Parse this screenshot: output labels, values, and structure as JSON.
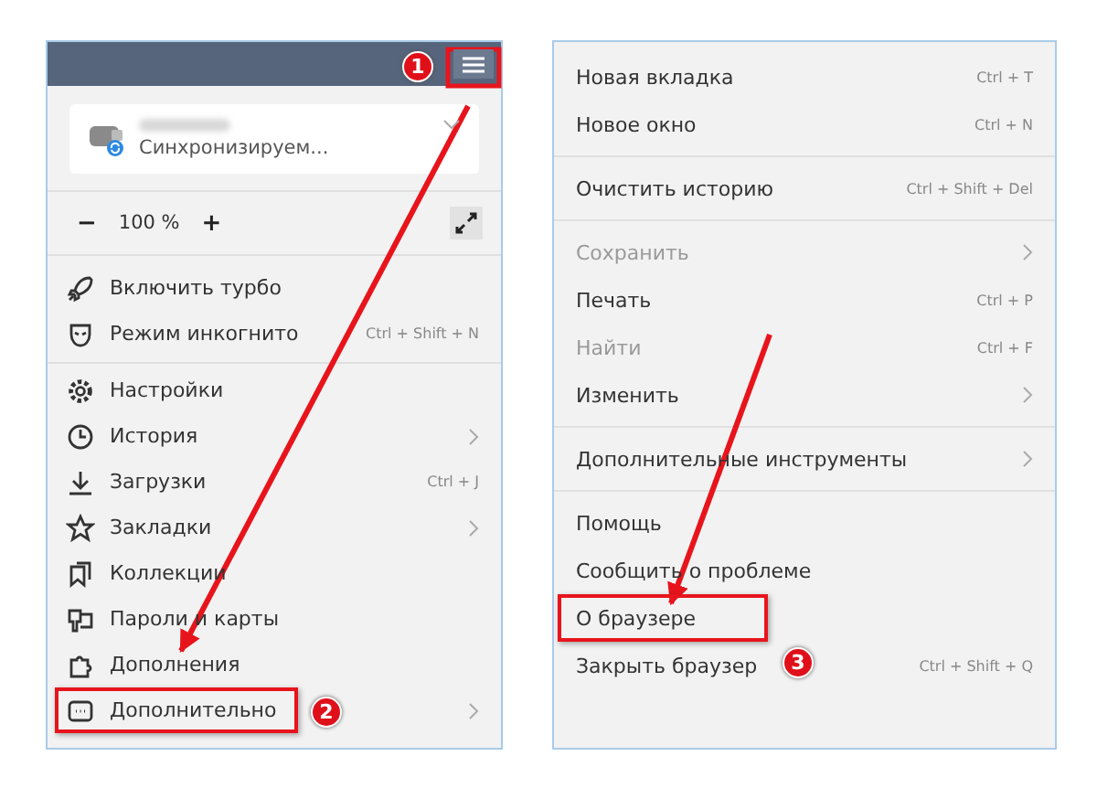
{
  "left_menu": {
    "account": {
      "status": "Синхронизируем..."
    },
    "zoom": {
      "minus": "−",
      "value": "100 %",
      "plus": "+"
    },
    "sections": [
      {
        "items": [
          {
            "label": "Включить турбо",
            "submenu": false,
            "highlighted": false
          },
          {
            "label": "Режим инкогнито",
            "shortcut": "Ctrl + Shift + N",
            "submenu": false,
            "highlighted": false
          }
        ]
      },
      {
        "items": [
          {
            "label": "Настройки",
            "submenu": false,
            "highlighted": false
          },
          {
            "label": "История",
            "submenu": true,
            "highlighted": false
          },
          {
            "label": "Загрузки",
            "shortcut": "Ctrl + J",
            "submenu": false,
            "highlighted": false
          },
          {
            "label": "Закладки",
            "submenu": true,
            "highlighted": false
          },
          {
            "label": "Коллекции",
            "submenu": false,
            "highlighted": false
          },
          {
            "label": "Пароли и карты",
            "submenu": false,
            "highlighted": false
          },
          {
            "label": "Дополнения",
            "submenu": false,
            "highlighted": false
          },
          {
            "label": "Дополнительно",
            "submenu": true,
            "highlighted": true
          }
        ]
      }
    ]
  },
  "right_menu": {
    "sections": [
      {
        "items": [
          {
            "label": "Новая вкладка",
            "shortcut": "Ctrl + T",
            "submenu": false,
            "disabled": false,
            "highlighted": false
          },
          {
            "label": "Новое окно",
            "shortcut": "Ctrl + N",
            "submenu": false,
            "disabled": false,
            "highlighted": false
          }
        ]
      },
      {
        "items": [
          {
            "label": "Очистить историю",
            "shortcut": "Ctrl + Shift + Del",
            "submenu": false,
            "disabled": false,
            "highlighted": false
          }
        ]
      },
      {
        "items": [
          {
            "label": "Сохранить",
            "submenu": true,
            "disabled": true,
            "highlighted": false
          },
          {
            "label": "Печать",
            "shortcut": "Ctrl + P",
            "submenu": false,
            "disabled": false,
            "highlighted": false
          },
          {
            "label": "Найти",
            "shortcut": "Ctrl + F",
            "submenu": false,
            "disabled": true,
            "highlighted": false
          },
          {
            "label": "Изменить",
            "submenu": true,
            "disabled": false,
            "highlighted": false
          }
        ]
      },
      {
        "items": [
          {
            "label": "Дополнительные инструменты",
            "submenu": true,
            "disabled": false,
            "highlighted": false
          }
        ]
      },
      {
        "items": [
          {
            "label": "Помощь",
            "submenu": false,
            "disabled": false,
            "highlighted": false
          },
          {
            "label": "Сообщить о проблеме",
            "submenu": false,
            "disabled": false,
            "highlighted": false
          },
          {
            "label": "О браузере",
            "submenu": false,
            "disabled": false,
            "highlighted": true
          },
          {
            "label": "Закрыть браузер",
            "shortcut": "Ctrl + Shift + Q",
            "submenu": false,
            "disabled": false,
            "highlighted": false
          }
        ]
      }
    ]
  },
  "steps": [
    {
      "number": "1"
    },
    {
      "number": "2"
    },
    {
      "number": "3"
    }
  ]
}
